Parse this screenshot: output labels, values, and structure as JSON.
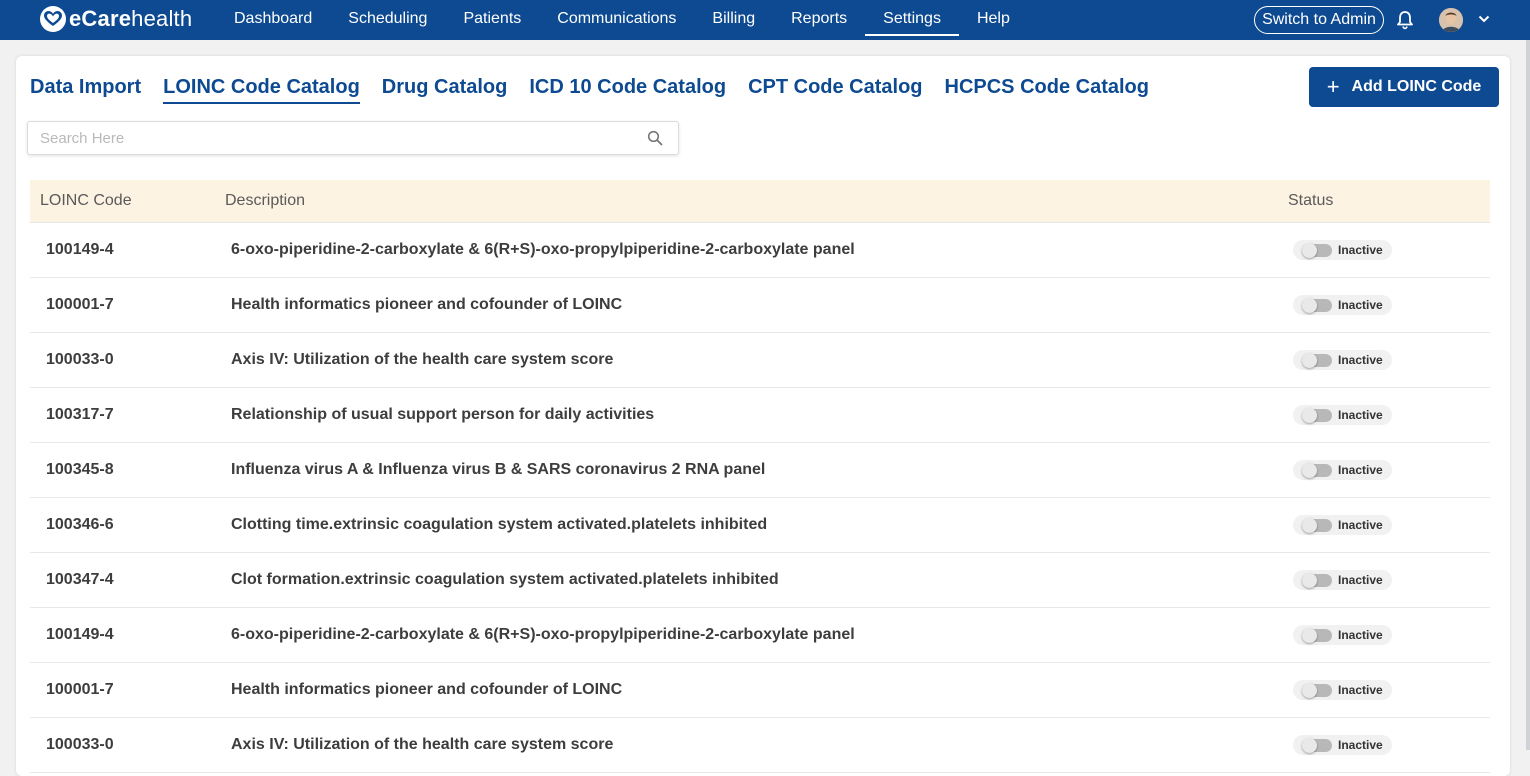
{
  "app": {
    "logo_prefix": "eCare",
    "logo_suffix": "health"
  },
  "nav": {
    "items": [
      {
        "label": "Dashboard"
      },
      {
        "label": "Scheduling"
      },
      {
        "label": "Patients"
      },
      {
        "label": "Communications"
      },
      {
        "label": "Billing"
      },
      {
        "label": "Reports"
      },
      {
        "label": "Settings",
        "active": true
      },
      {
        "label": "Help"
      }
    ],
    "switch_label": "Switch to Admin"
  },
  "tabs": [
    {
      "label": "Data Import"
    },
    {
      "label": "LOINC Code Catalog",
      "active": true
    },
    {
      "label": "Drug Catalog"
    },
    {
      "label": "ICD 10 Code Catalog"
    },
    {
      "label": "CPT Code Catalog"
    },
    {
      "label": "HCPCS Code Catalog"
    }
  ],
  "add_button": {
    "label": "Add LOINC Code"
  },
  "search": {
    "placeholder": "Search Here",
    "value": ""
  },
  "table": {
    "columns": {
      "code": "LOINC Code",
      "description": "Description",
      "status": "Status"
    },
    "rows": [
      {
        "code": "100149-4",
        "description": "6-oxo-piperidine-2-carboxylate & 6(R+S)-oxo-propylpiperidine-2-carboxylate panel",
        "status": "Inactive"
      },
      {
        "code": "100001-7",
        "description": "Health informatics pioneer and cofounder of LOINC",
        "status": "Inactive"
      },
      {
        "code": "100033-0",
        "description": "Axis IV: Utilization of the health care system score",
        "status": "Inactive"
      },
      {
        "code": "100317-7",
        "description": "Relationship of usual support person for daily activities",
        "status": "Inactive"
      },
      {
        "code": "100345-8",
        "description": "Influenza virus A & Influenza virus B & SARS coronavirus 2 RNA panel",
        "status": "Inactive"
      },
      {
        "code": "100346-6",
        "description": "Clotting time.extrinsic coagulation system activated.platelets inhibited",
        "status": "Inactive"
      },
      {
        "code": "100347-4",
        "description": "Clot formation.extrinsic coagulation system activated.platelets inhibited",
        "status": "Inactive"
      },
      {
        "code": "100149-4",
        "description": "6-oxo-piperidine-2-carboxylate & 6(R+S)-oxo-propylpiperidine-2-carboxylate panel",
        "status": "Inactive"
      },
      {
        "code": "100001-7",
        "description": "Health informatics pioneer and cofounder of LOINC",
        "status": "Inactive"
      },
      {
        "code": "100033-0",
        "description": "Axis IV: Utilization of the health care system score",
        "status": "Inactive"
      }
    ]
  },
  "colors": {
    "brand": "#0d4a91",
    "table_header_bg": "#fdf3e3"
  },
  "icons": {
    "search": "search-icon",
    "notification": "bell-icon",
    "account_menu": "chevron-down-icon",
    "add": "plus-icon"
  }
}
